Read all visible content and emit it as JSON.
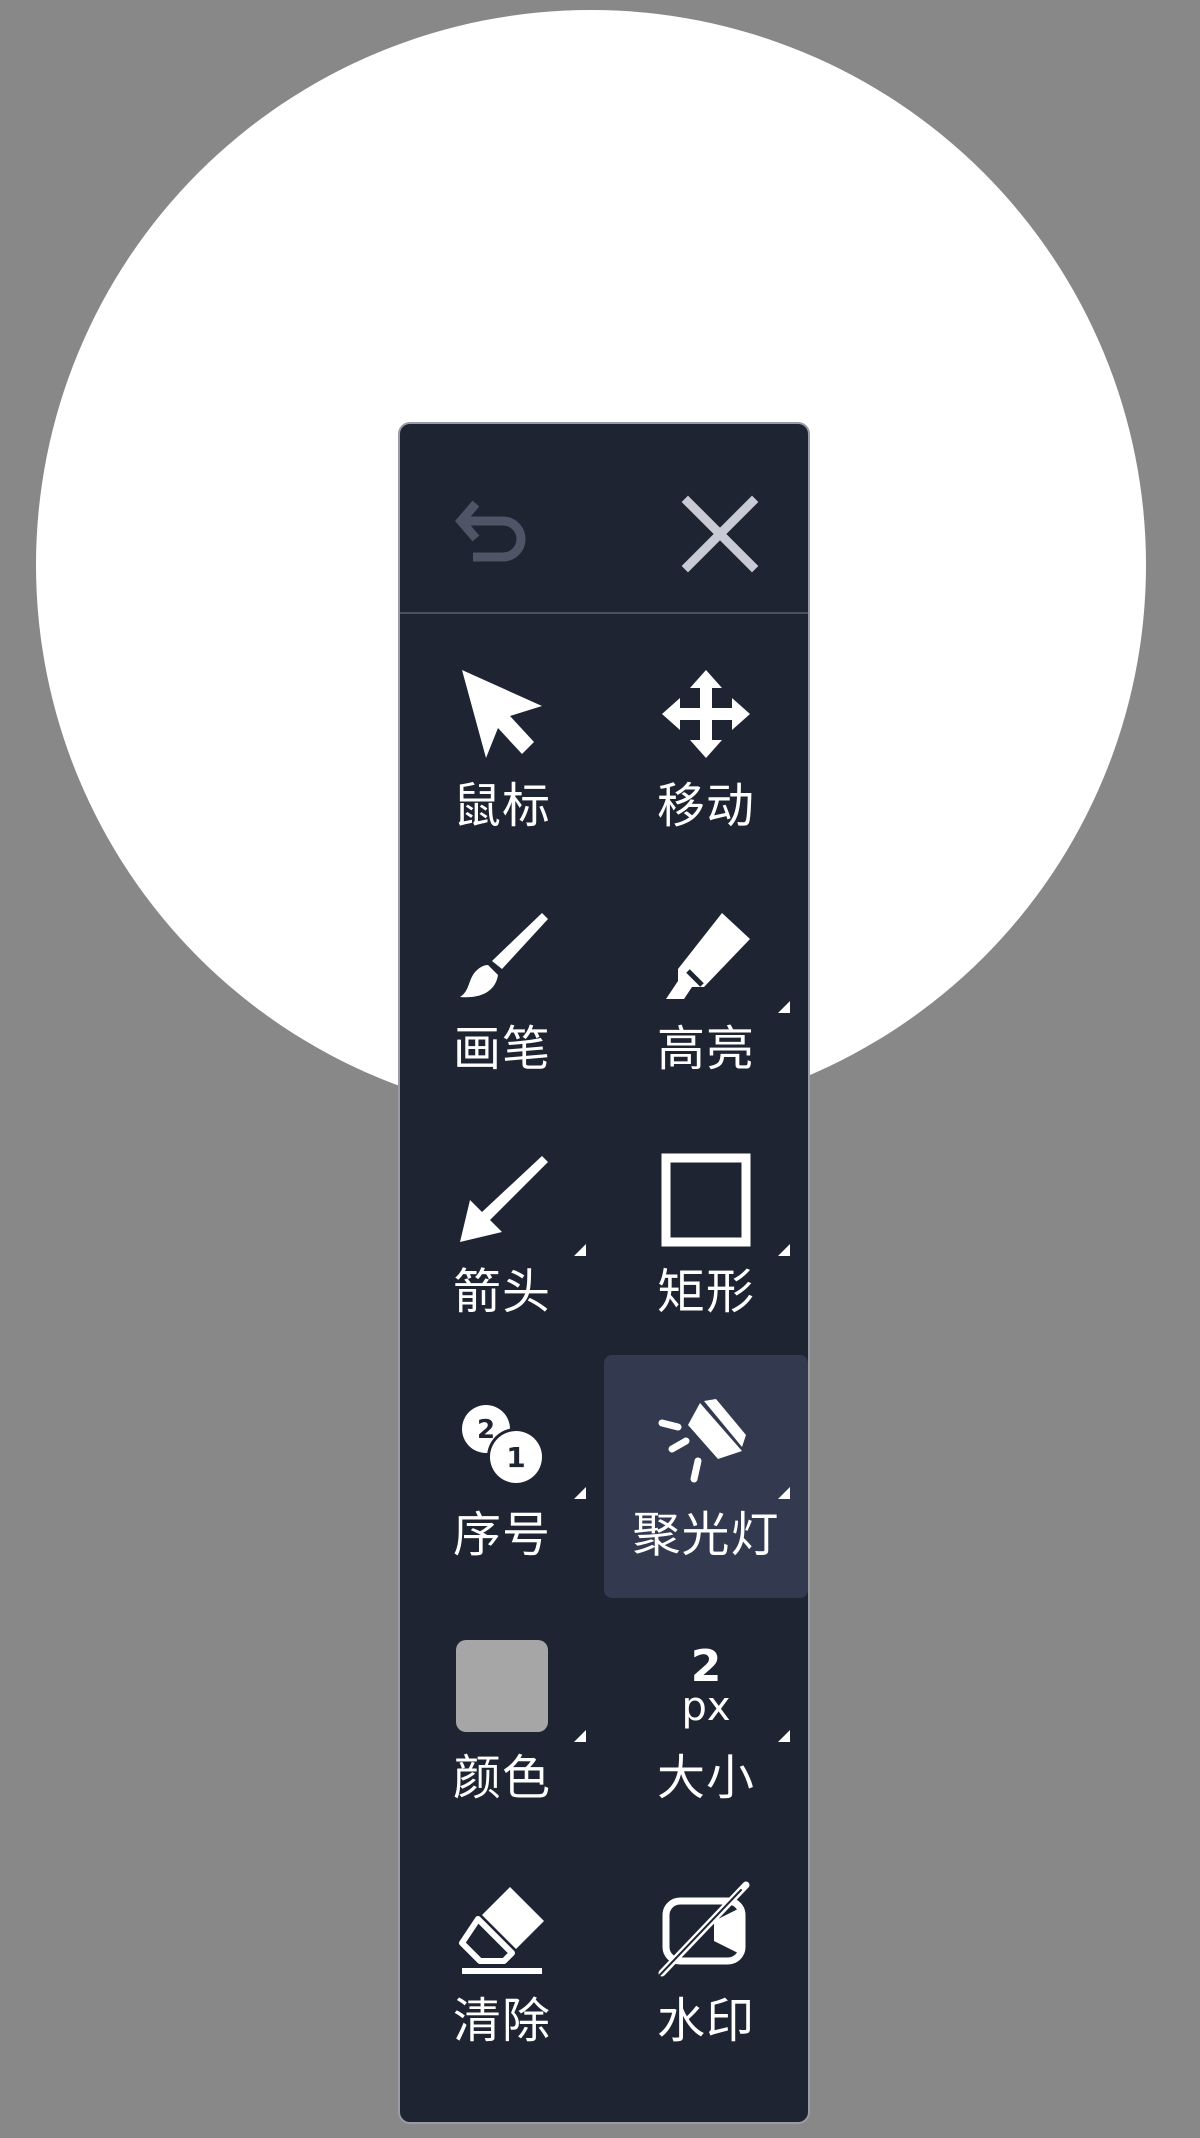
{
  "toolbar": {
    "header": {
      "undo_icon": "undo-icon",
      "close_icon": "close-icon"
    },
    "tools": [
      {
        "label": "鼠标",
        "icon": "cursor-icon"
      },
      {
        "label": "移动",
        "icon": "move-icon"
      },
      {
        "label": "画笔",
        "icon": "brush-icon"
      },
      {
        "label": "高亮",
        "icon": "highlighter-icon"
      },
      {
        "label": "箭头",
        "icon": "arrow-icon"
      },
      {
        "label": "矩形",
        "icon": "rectangle-icon"
      },
      {
        "label": "序号",
        "icon": "sequence-number-icon"
      },
      {
        "label": "聚光灯",
        "icon": "spotlight-icon",
        "active": true
      },
      {
        "label": "颜色",
        "icon": "color-swatch-icon",
        "color": "#a6a6a6"
      },
      {
        "label": "大小",
        "icon": "size-icon",
        "size_value": "2",
        "size_unit": "px"
      },
      {
        "label": "清除",
        "icon": "eraser-icon"
      },
      {
        "label": "水印",
        "icon": "watermark-icon"
      }
    ],
    "sequence_badge_numbers": [
      "2",
      "1"
    ]
  },
  "colors": {
    "background": "#888888",
    "spotlight": "#ffffff",
    "toolbar_bg": "#1f2433",
    "active_bg": "#333a4f",
    "icon_fg": "#ffffff",
    "undo_disabled": "#4f5566",
    "close_fg": "#c8cbd3"
  }
}
